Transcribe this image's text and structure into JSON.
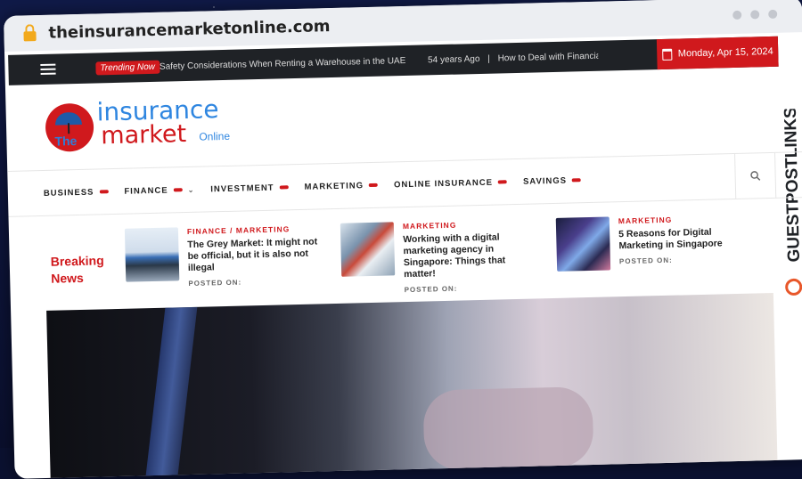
{
  "browser": {
    "url": "theinsurancemarketonline.com"
  },
  "topbar": {
    "trending_label": "Trending Now",
    "ticker_items": [
      "Safety Considerations When Renting a Warehouse in the UAE",
      "54 years Ago",
      "|",
      "How to Deal with Financial Emerger"
    ],
    "date": "Monday, Apr 15, 2024"
  },
  "logo": {
    "the": "The",
    "insurance": "insurance",
    "market": "market",
    "online": "Online"
  },
  "watermark": "GUESTPOSTLINKS",
  "nav": {
    "items": [
      "BUSINESS",
      "FINANCE",
      "INVESTMENT",
      "MARKETING",
      "ONLINE INSURANCE",
      "SAVINGS"
    ]
  },
  "breaking": {
    "title": "Breaking News",
    "cards": [
      {
        "category": "FINANCE / MARKETING",
        "title": "The Grey Market: It might not be official, but it is also not illegal",
        "posted": "POSTED ON:"
      },
      {
        "category": "MARKETING",
        "title": "Working with a digital marketing agency in Singapore: Things that matter!",
        "posted": "POSTED ON:"
      },
      {
        "category": "MARKETING",
        "title": "5 Reasons for Digital Marketing in Singapore",
        "posted": "POSTED ON:"
      }
    ]
  },
  "colors": {
    "brand_red": "#d0191d",
    "brand_blue": "#2f86e0",
    "topbar_dark": "#1f2226"
  }
}
